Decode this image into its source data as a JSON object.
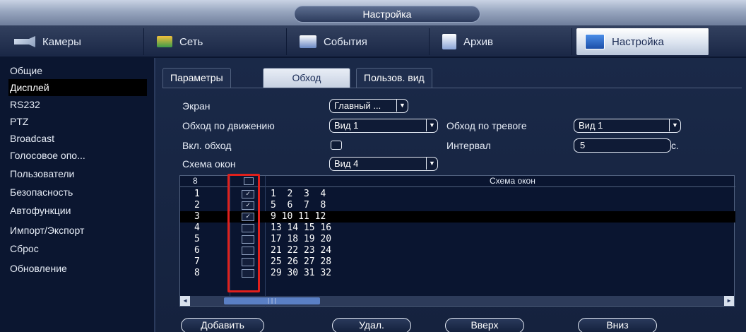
{
  "window": {
    "title": "Настройка"
  },
  "main_tabs": [
    {
      "label": "Камеры",
      "icon": "camera-icon"
    },
    {
      "label": "Сеть",
      "icon": "network-icon"
    },
    {
      "label": "События",
      "icon": "events-icon"
    },
    {
      "label": "Архив",
      "icon": "archive-icon"
    },
    {
      "label": "Настройка",
      "icon": "settings-icon",
      "active": true
    }
  ],
  "sidebar": {
    "items": [
      {
        "label": "Общие"
      },
      {
        "label": "Дисплей",
        "active": true
      },
      {
        "label": "RS232"
      },
      {
        "label": "PTZ"
      },
      {
        "label": "Broadcast"
      },
      {
        "label": "Голосовое опо..."
      },
      {
        "label": "Пользователи"
      },
      {
        "label": "Безопасность"
      },
      {
        "label": "Автофункции"
      },
      {
        "label": "Импорт/Экспорт"
      },
      {
        "label": "Сброс"
      },
      {
        "label": "Обновление"
      }
    ]
  },
  "sub_tabs": [
    {
      "label": "Параметры"
    },
    {
      "label": "Обход",
      "active": true
    },
    {
      "label": "Пользов. вид"
    }
  ],
  "form": {
    "screen_label": "Экран",
    "screen_value": "Главный ...",
    "motion_tour_label": "Обход по движению",
    "motion_tour_value": "Вид 1",
    "alarm_tour_label": "Обход по тревоге",
    "alarm_tour_value": "Вид 1",
    "enable_tour_label": "Вкл. обход",
    "enable_tour_checked": false,
    "interval_label": "Интервал",
    "interval_value": "5",
    "interval_unit": "с.",
    "layout_label": "Схема окон",
    "layout_value": "Вид 4"
  },
  "table": {
    "header_count": "8",
    "header_title": "Схема окон",
    "rows": [
      {
        "num": "1",
        "checked": true,
        "check_mark": "✓",
        "channels": "1  2  3  4"
      },
      {
        "num": "2",
        "checked": true,
        "check_mark": "✓",
        "channels": "5  6  7  8"
      },
      {
        "num": "3",
        "checked": true,
        "check_mark": "✓",
        "channels": "9 10 11 12",
        "selected": true
      },
      {
        "num": "4",
        "checked": false,
        "check_mark": "",
        "channels": "13 14 15 16"
      },
      {
        "num": "5",
        "checked": false,
        "check_mark": "",
        "channels": "17 18 19 20"
      },
      {
        "num": "6",
        "checked": false,
        "check_mark": "",
        "channels": "21 22 23 24"
      },
      {
        "num": "7",
        "checked": false,
        "check_mark": "",
        "channels": "25 26 27 28"
      },
      {
        "num": "8",
        "checked": false,
        "check_mark": "",
        "channels": "29 30 31 32"
      }
    ],
    "scroll_thumb_grip": "|||"
  },
  "buttons": {
    "add": "Добавить",
    "delete": "Удал.",
    "up": "Вверх",
    "down": "Вниз"
  },
  "colors": {
    "background": "#0b1630",
    "panel": "#1a2948",
    "highlight_box": "#e0201c",
    "active_tab": "#dbe3ef"
  }
}
